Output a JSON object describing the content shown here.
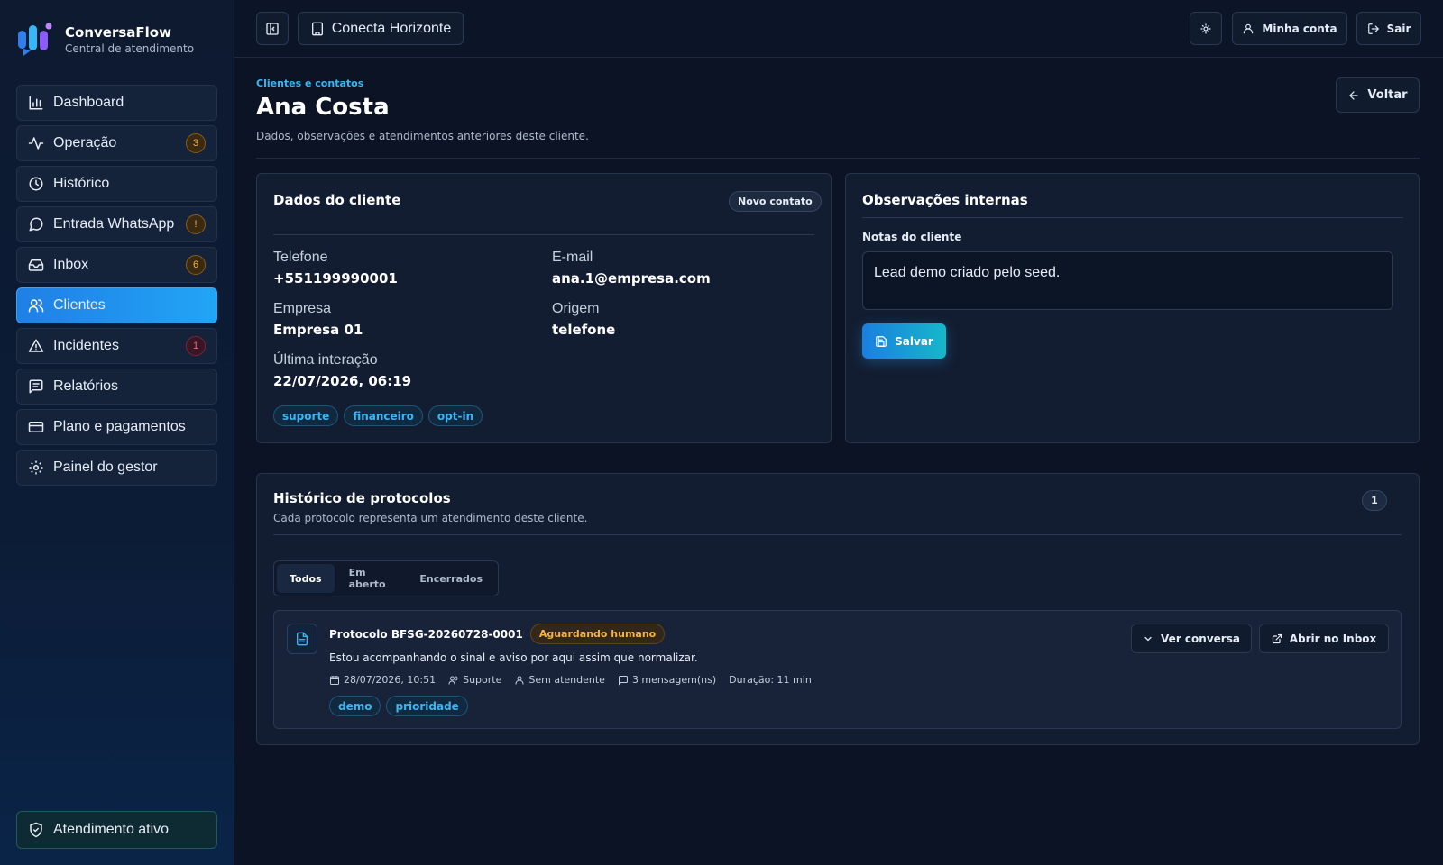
{
  "app": {
    "name": "ConversaFlow",
    "subtitle": "Central de atendimento"
  },
  "sidebar": {
    "items": [
      {
        "label": "Dashboard",
        "icon": "bar-chart-icon",
        "badge": ""
      },
      {
        "label": "Operação",
        "icon": "activity-icon",
        "badge": "3"
      },
      {
        "label": "Histórico",
        "icon": "clock-icon",
        "badge": ""
      },
      {
        "label": "Entrada WhatsApp",
        "icon": "message-circle-icon",
        "badge": "!"
      },
      {
        "label": "Inbox",
        "icon": "inbox-icon",
        "badge": "6"
      },
      {
        "label": "Clientes",
        "icon": "users-icon",
        "badge": "",
        "active": true
      },
      {
        "label": "Incidentes",
        "icon": "alert-triangle-icon",
        "badge": "1"
      },
      {
        "label": "Relatórios",
        "icon": "message-square-text-icon",
        "badge": ""
      },
      {
        "label": "Plano e pagamentos",
        "icon": "credit-card-icon",
        "badge": ""
      },
      {
        "label": "Painel do gestor",
        "icon": "settings-icon",
        "badge": ""
      }
    ],
    "status_label": "Atendimento ativo"
  },
  "topbar": {
    "workspace": "Conecta Horizonte",
    "account_label": "Minha conta",
    "logout_label": "Sair"
  },
  "page": {
    "breadcrumb": "Clientes e contatos",
    "title": "Ana Costa",
    "subtitle": "Dados, observações e atendimentos anteriores deste cliente.",
    "back_label": "Voltar"
  },
  "client": {
    "card_title": "Dados do cliente",
    "status_pill": "Novo contato",
    "phone_label": "Telefone",
    "phone": "+551199990001",
    "email_label": "E-mail",
    "email": "ana.1@empresa.com",
    "company_label": "Empresa",
    "company": "Empresa 01",
    "origin_label": "Origem",
    "origin": "telefone",
    "last_label": "Última interação",
    "last": "22/07/2026, 06:19",
    "tags": [
      "suporte",
      "financeiro",
      "opt-in"
    ]
  },
  "notes": {
    "card_title": "Observações internas",
    "label": "Notas do cliente",
    "value": "Lead demo criado pelo seed.",
    "save_label": "Salvar"
  },
  "history": {
    "title": "Histórico de protocolos",
    "subtitle": "Cada protocolo representa um atendimento deste cliente.",
    "count": "1",
    "tabs": [
      "Todos",
      "Em aberto",
      "Encerrados"
    ],
    "protocol": {
      "title": "Protocolo BFSG-20260728-0001",
      "status": "Aguardando humano",
      "message": "Estou acompanhando o sinal e aviso por aqui assim que normalizar.",
      "date": "28/07/2026, 10:51",
      "team": "Suporte",
      "agent": "Sem atendente",
      "messages": "3 mensagem(ns)",
      "duration": "Duração: 11 min",
      "tags": [
        "demo",
        "prioridade"
      ],
      "view_label": "Ver conversa",
      "open_label": "Abrir no Inbox"
    }
  },
  "colors": {
    "accent": "#22a5f5",
    "warning": "#f5b342",
    "danger": "#f06a86",
    "teal": "#16b7c9"
  }
}
